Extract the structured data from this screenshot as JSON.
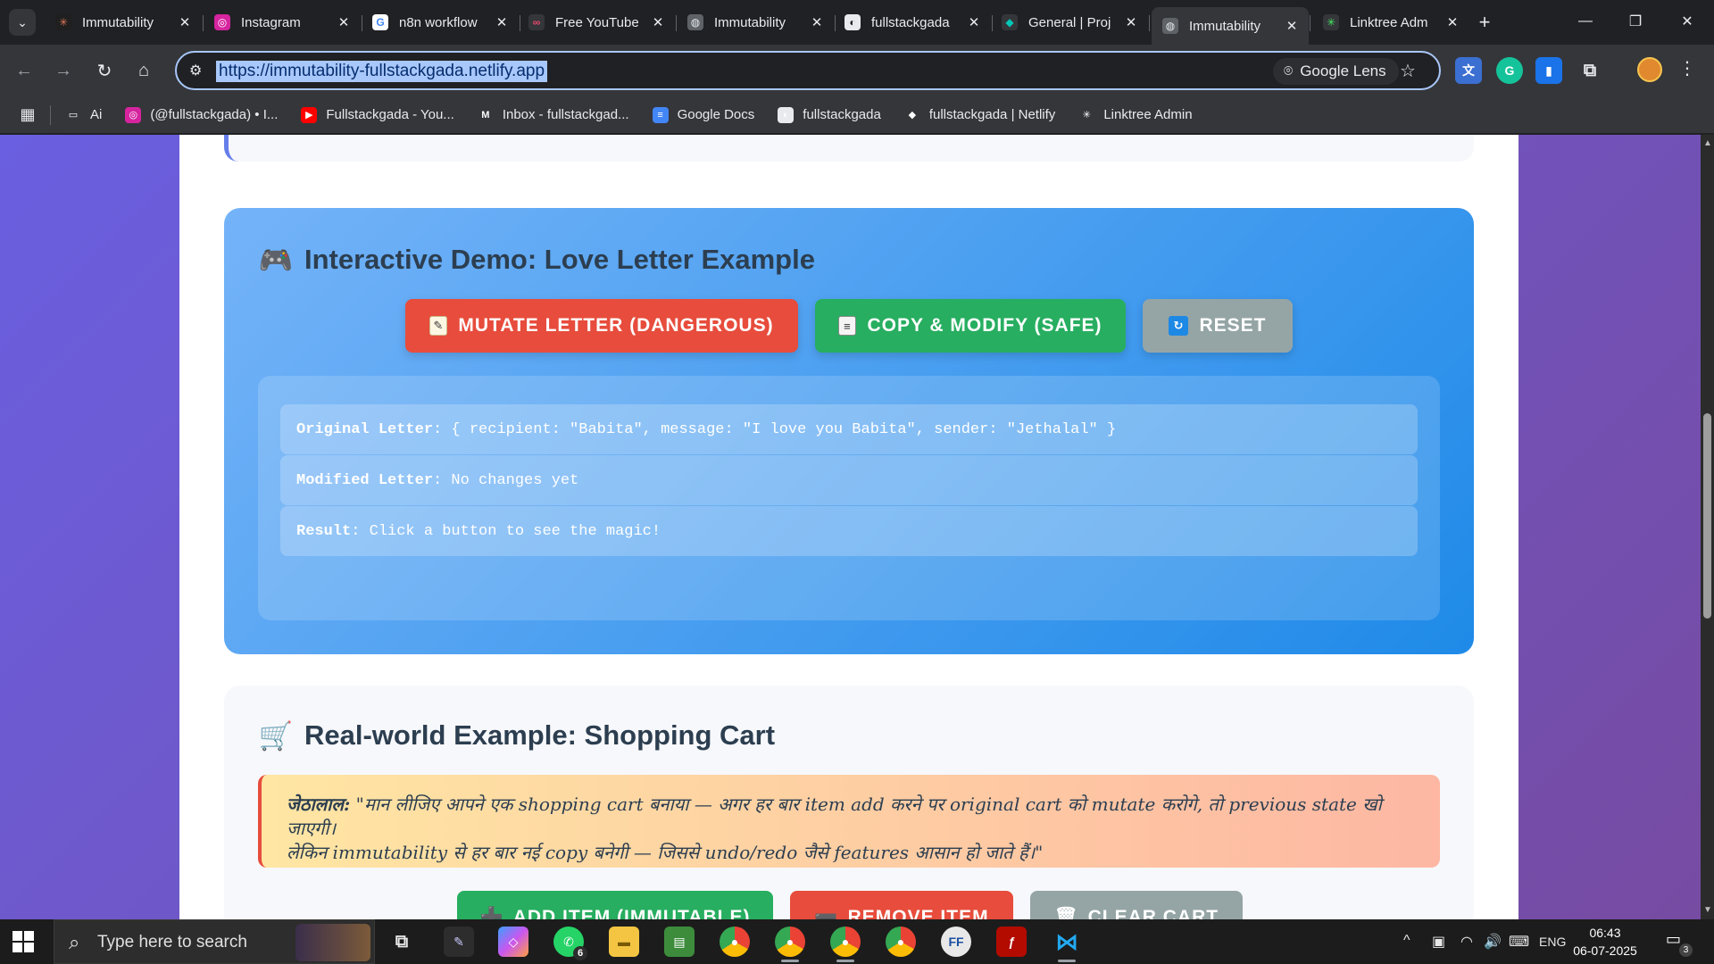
{
  "browser": {
    "tabs": [
      {
        "label": "Immutability",
        "fav_color": "#1f1f1f",
        "fav_glyph": "✳",
        "fav_fg": "#e0765a"
      },
      {
        "label": "Instagram",
        "fav_color": "#d6249f",
        "fav_glyph": "◎",
        "fav_fg": "#ffffff"
      },
      {
        "label": "n8n workflow",
        "fav_color": "#ffffff",
        "fav_glyph": "G",
        "fav_fg": "#4285f4"
      },
      {
        "label": "Free YouTube",
        "fav_color": "#35363a",
        "fav_glyph": "∞",
        "fav_fg": "#e8476b"
      },
      {
        "label": "Immutability",
        "fav_color": "#5f6368",
        "fav_glyph": "◍",
        "fav_fg": "#e8eaed"
      },
      {
        "label": "fullstackgada",
        "fav_color": "#e8eaed",
        "fav_glyph": "◐",
        "fav_fg": "#202124"
      },
      {
        "label": "General | Proj",
        "fav_color": "#35363a",
        "fav_glyph": "◆",
        "fav_fg": "#00c7b7"
      },
      {
        "label": "Immutability",
        "fav_color": "#5f6368",
        "fav_glyph": "◍",
        "fav_fg": "#e8eaed"
      },
      {
        "label": "Linktree Adm",
        "fav_color": "#35363a",
        "fav_glyph": "✳",
        "fav_fg": "#43e660"
      }
    ],
    "active_tab_index": 7,
    "url": "https://immutability-fullstackgada.netlify.app",
    "lens_label": "Google Lens",
    "bookmarks": [
      {
        "label": "Ai",
        "icon": "folder-icon",
        "fav_color": "#35363a",
        "glyph": "▭"
      },
      {
        "label": "(@fullstackgada) • I...",
        "icon": "instagram-icon",
        "fav_color": "#d6249f",
        "glyph": "◎"
      },
      {
        "label": "Fullstackgada - You...",
        "icon": "youtube-icon",
        "fav_color": "#ff0000",
        "glyph": "▶"
      },
      {
        "label": "Inbox - fullstackgad...",
        "icon": "gmail-icon",
        "fav_color": "#35363a",
        "glyph": "M"
      },
      {
        "label": "Google Docs",
        "icon": "google-docs-icon",
        "fav_color": "#4285f4",
        "glyph": "≡"
      },
      {
        "label": "fullstackgada",
        "icon": "github-icon",
        "fav_color": "#e8eaed",
        "glyph": "◐"
      },
      {
        "label": "fullstackgada | Netlify",
        "icon": "netlify-icon",
        "fav_color": "#35363a",
        "glyph": "◆"
      },
      {
        "label": "Linktree Admin",
        "icon": "linktree-icon",
        "fav_color": "#35363a",
        "glyph": "✳"
      }
    ]
  },
  "page": {
    "demo": {
      "title": "Interactive Demo: Love Letter Example",
      "title_icon": "🎮",
      "mutate_label": "MUTATE LETTER (DANGEROUS)",
      "copy_label": "COPY & MODIFY (SAFE)",
      "reset_label": "RESET",
      "original_label": "Original Letter",
      "original_value": ": { recipient: \"Babita\", message: \"I love you Babita\", sender: \"Jethalal\" }",
      "modified_label": "Modified Letter",
      "modified_value": ": No changes yet",
      "result_label": "Result",
      "result_value": ": Click a button to see the magic!"
    },
    "cart": {
      "title": "Real-world Example: Shopping Cart",
      "title_icon": "🛒",
      "quote_speaker": "जेठालाल:",
      "quote_line1": " \"मान लीजिए आपने एक shopping cart बनाया — अगर हर बार item add करने पर original cart को mutate करोगे, तो previous state खो जाएगी।",
      "quote_line2": "लेकिन immutability से हर बार नई copy बनेगी — जिससे undo/redo जैसे features आसान हो जाते हैं।\"",
      "add_label": "ADD ITEM (IMMUTABLE)",
      "remove_label": "REMOVE ITEM",
      "clear_label": "CLEAR CART"
    },
    "colors": {
      "danger": "#e74c3c",
      "safe": "#27ae60",
      "neutral": "#95a5a6",
      "demo_bg_start": "#74b3f8",
      "demo_bg_end": "#1f8ae8"
    }
  },
  "taskbar": {
    "search_placeholder": "Type here to search",
    "whatsapp_badge": "6",
    "language": "ENG",
    "time": "06:43",
    "date": "06-07-2025",
    "notification_count": "3"
  }
}
